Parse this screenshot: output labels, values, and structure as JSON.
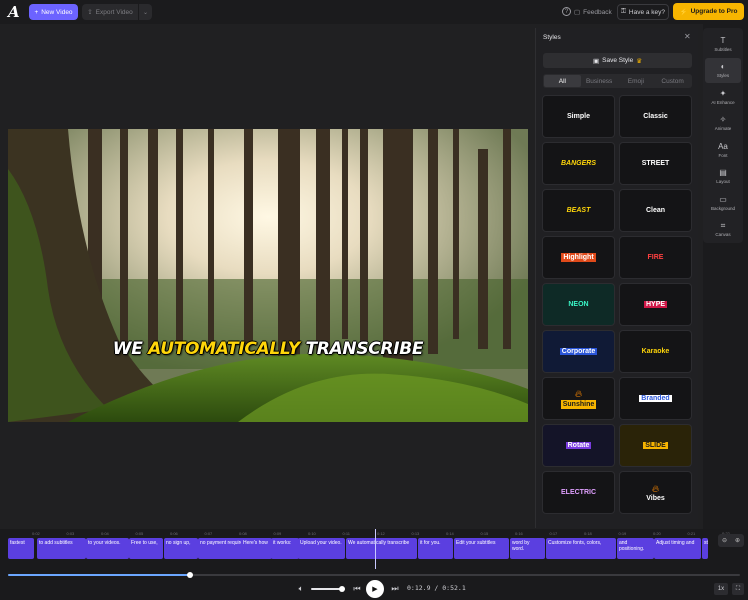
{
  "topbar": {
    "new_video": "New Video",
    "export_video": "Export Video",
    "feedback": "Feedback",
    "have_key": "Have a key?",
    "upgrade": "Upgrade to Pro"
  },
  "caption": {
    "pre": "WE ",
    "highlight": "AUTOMATICALLY",
    "post": " TRANSCRIBE"
  },
  "panel": {
    "title": "Styles",
    "save_style": "Save Style",
    "tabs": [
      "All",
      "Business",
      "Emoji",
      "Custom"
    ],
    "styles": [
      {
        "label": "Simple",
        "color": "#ffffff",
        "bg": "#141416"
      },
      {
        "label": "Classic",
        "color": "#ffffff",
        "bg": "#141416"
      },
      {
        "label": "BANGERS",
        "color": "#ffd60a",
        "bg": "#141416"
      },
      {
        "label": "STREET",
        "color": "#ffffff",
        "bg": "#141416"
      },
      {
        "label": "BEAST",
        "color": "#ffd60a",
        "bg": "#141416"
      },
      {
        "label": "Clean",
        "color": "#ffffff",
        "bg": "#141416"
      },
      {
        "label": "Highlight",
        "color": "#ffffff",
        "bg": "#141416"
      },
      {
        "label": "FIRE",
        "color": "#ff4040",
        "bg": "#141416"
      },
      {
        "label": "NEON",
        "color": "#39f5c6",
        "bg": "#0e2a26"
      },
      {
        "label": "HYPE",
        "color": "#ffffff",
        "bg": "#141416"
      },
      {
        "label": "Corporate",
        "color": "#ffffff",
        "bg": "#101a36"
      },
      {
        "label": "Karaoke",
        "color": "#ffd60a",
        "bg": "#141416"
      },
      {
        "label": "Sunshine",
        "color": "#1a1a1a",
        "bg": "#141416"
      },
      {
        "label": "Branded",
        "color": "#2a55d8",
        "bg": "#141416"
      },
      {
        "label": "Rotate",
        "color": "#ffffff",
        "bg": "#141428"
      },
      {
        "label": "SLIDE",
        "color": "#1a1a1a",
        "bg": "#2a2308"
      },
      {
        "label": "ELECTRIC",
        "color": "#e0a0ff",
        "bg": "#141416"
      },
      {
        "label": "Vibes",
        "color": "#ffffff",
        "bg": "#141416"
      }
    ]
  },
  "rail": [
    {
      "label": "Subtitles",
      "icon": "T"
    },
    {
      "label": "Styles",
      "icon": "◐"
    },
    {
      "label": "AI Enhance",
      "icon": "✦"
    },
    {
      "label": "Animate",
      "icon": "✧"
    },
    {
      "label": "Font",
      "icon": "Aa"
    },
    {
      "label": "Layout",
      "icon": "▤"
    },
    {
      "label": "Background",
      "icon": "▭"
    },
    {
      "label": "Canvas",
      "icon": "⌗"
    }
  ],
  "timeline": {
    "ticks": [
      "0:02",
      "0:03",
      "0:04",
      "0:05",
      "0:06",
      "0:07",
      "0:08",
      "0:09",
      "0:10",
      "0:11",
      "0:12",
      "0:13",
      "0:14",
      "0:15",
      "0:16",
      "0:17",
      "0:18",
      "0:19",
      "0:20",
      "0:21",
      "0:22",
      "0:23"
    ],
    "clips": [
      {
        "text": "fastest"
      },
      {
        "text": "to add subtitles"
      },
      {
        "text": "to your videos."
      },
      {
        "text": "Free to use,"
      },
      {
        "text": "no sign up,"
      },
      {
        "text": "no payment required."
      },
      {
        "text": "Here's how"
      },
      {
        "text": "it works:"
      },
      {
        "text": "Upload your video."
      },
      {
        "text": "We automatically transcribe"
      },
      {
        "text": "it for you."
      },
      {
        "text": "Edit your subtitles"
      },
      {
        "text": "word by word."
      },
      {
        "text": "Customize fonts, colors,"
      },
      {
        "text": "and positioning."
      },
      {
        "text": "Adjust timing and"
      },
      {
        "text": "style"
      }
    ],
    "progress": 0.248,
    "current_time": "0:12.9",
    "time_sep": "/",
    "total_time": "0:52.1",
    "speed": "1x"
  }
}
